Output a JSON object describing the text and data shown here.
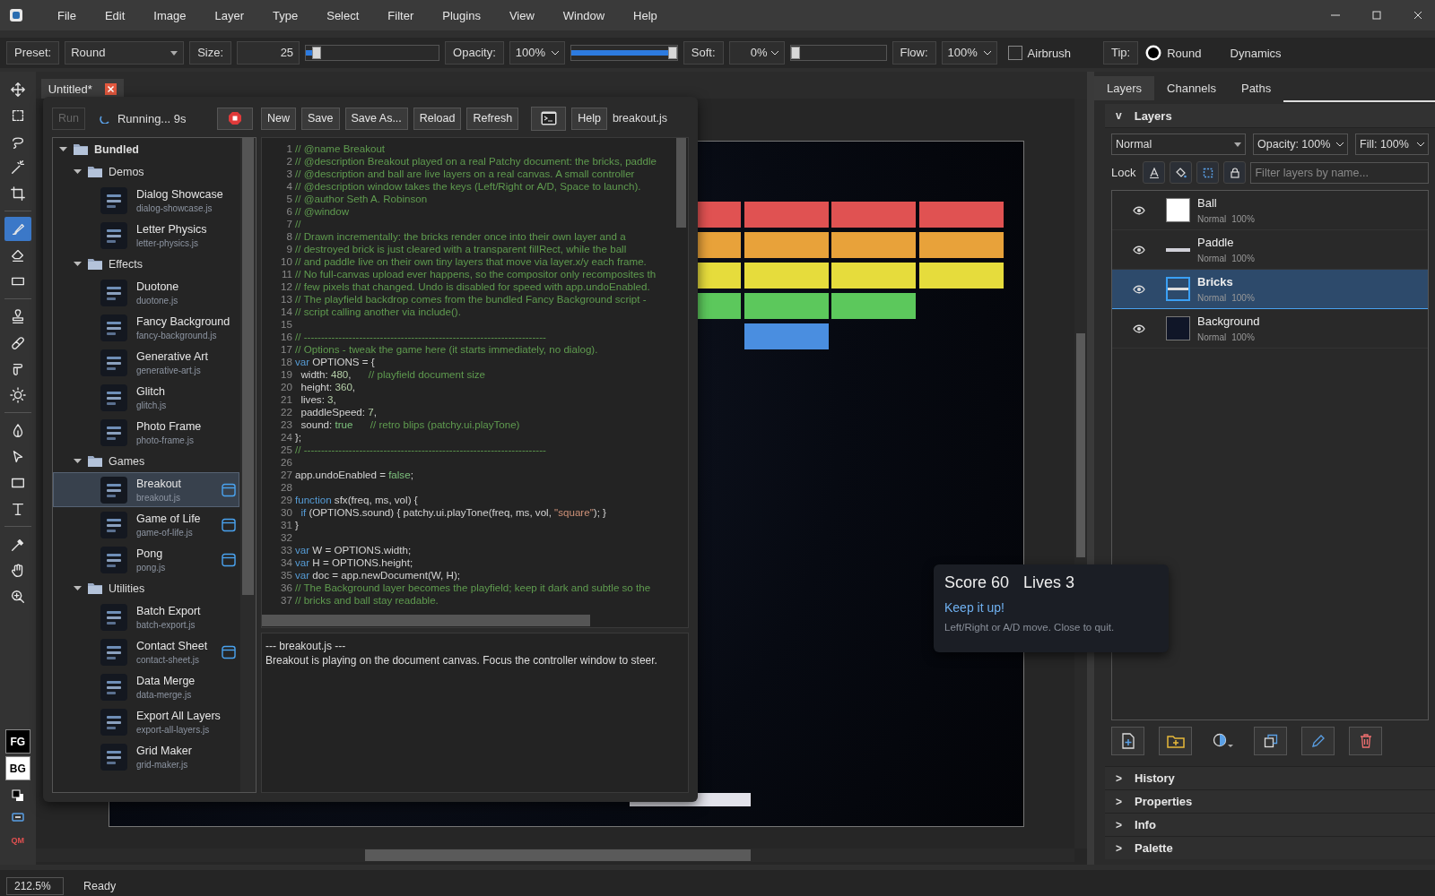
{
  "menu": [
    "File",
    "Edit",
    "Image",
    "Layer",
    "Type",
    "Select",
    "Filter",
    "Plugins",
    "View",
    "Window",
    "Help"
  ],
  "tool_options": {
    "preset_label": "Preset:",
    "preset": "Round",
    "size_label": "Size:",
    "size": "25",
    "size_slider": {
      "level": 0.05
    },
    "opacity_label": "Opacity:",
    "opacity": "100%",
    "opacity_slider": {
      "level": 1
    },
    "soft_label": "Soft:",
    "soft": "0%",
    "soft_slider": {
      "level": 0
    },
    "flow_label": "Flow:",
    "flow": "100%",
    "airbrush": {
      "label": "Airbrush",
      "checked": false
    },
    "tip_label": "Tip:",
    "tip": "Round",
    "dynamics": "Dynamics"
  },
  "tools": [
    {
      "kind": "move",
      "selected": false,
      "separator_after": false
    },
    {
      "kind": "marquee",
      "selected": false,
      "separator_after": false
    },
    {
      "kind": "lasso",
      "selected": false,
      "separator_after": false
    },
    {
      "kind": "wand",
      "selected": false,
      "separator_after": false
    },
    {
      "kind": "crop",
      "selected": false,
      "separator_after": true
    },
    {
      "kind": "brush",
      "selected": true,
      "separator_after": false
    },
    {
      "kind": "eraser",
      "selected": false,
      "separator_after": false
    },
    {
      "kind": "gradient",
      "selected": false,
      "separator_after": true
    },
    {
      "kind": "stamp",
      "selected": false,
      "separator_after": false
    },
    {
      "kind": "heal",
      "selected": false,
      "separator_after": false
    },
    {
      "kind": "smudge",
      "selected": false,
      "separator_after": false
    },
    {
      "kind": "dodge",
      "selected": false,
      "separator_after": true
    },
    {
      "kind": "pen",
      "selected": false,
      "separator_after": false
    },
    {
      "kind": "pointer",
      "selected": false,
      "separator_after": false
    },
    {
      "kind": "rect",
      "selected": false,
      "separator_after": false
    },
    {
      "kind": "text",
      "selected": false,
      "separator_after": true
    },
    {
      "kind": "eyedropper",
      "selected": false,
      "separator_after": false
    },
    {
      "kind": "hand",
      "selected": false,
      "separator_after": false
    },
    {
      "kind": "zoom",
      "selected": false,
      "separator_after": false
    }
  ],
  "colors": {
    "fg": "FG",
    "bg": "BG",
    "quick_mask": "QM"
  },
  "document": {
    "tab": "Untitled*"
  },
  "script_editor": {
    "run": {
      "label": "Run",
      "disabled": true
    },
    "status": "Running... 9s",
    "buttons": [
      "New",
      "Save",
      "Save As...",
      "Reload",
      "Refresh"
    ],
    "help": "Help",
    "file": "breakout.js",
    "tree": [
      {
        "kind": "folder",
        "name": "Bundled",
        "expanded": true,
        "children": [
          {
            "kind": "folder",
            "name": "Demos",
            "expanded": true,
            "children": [
              {
                "kind": "script",
                "name": "Dialog Showcase",
                "file": "dialog-showcase.js",
                "window": false,
                "selected": false
              },
              {
                "kind": "script",
                "name": "Letter Physics",
                "file": "letter-physics.js",
                "window": false,
                "selected": false
              }
            ]
          },
          {
            "kind": "folder",
            "name": "Effects",
            "expanded": true,
            "children": [
              {
                "kind": "script",
                "name": "Duotone",
                "file": "duotone.js",
                "window": false,
                "selected": false
              },
              {
                "kind": "script",
                "name": "Fancy Background",
                "file": "fancy-background.js",
                "window": false,
                "selected": false
              },
              {
                "kind": "script",
                "name": "Generative Art",
                "file": "generative-art.js",
                "window": false,
                "selected": false
              },
              {
                "kind": "script",
                "name": "Glitch",
                "file": "glitch.js",
                "window": false,
                "selected": false
              },
              {
                "kind": "script",
                "name": "Photo Frame",
                "file": "photo-frame.js",
                "window": false,
                "selected": false
              }
            ]
          },
          {
            "kind": "folder",
            "name": "Games",
            "expanded": true,
            "children": [
              {
                "kind": "script",
                "name": "Breakout",
                "file": "breakout.js",
                "window": true,
                "selected": true
              },
              {
                "kind": "script",
                "name": "Game of Life",
                "file": "game-of-life.js",
                "window": true,
                "selected": false
              },
              {
                "kind": "script",
                "name": "Pong",
                "file": "pong.js",
                "window": true,
                "selected": false
              }
            ]
          },
          {
            "kind": "folder",
            "name": "Utilities",
            "expanded": true,
            "children": [
              {
                "kind": "script",
                "name": "Batch Export",
                "file": "batch-export.js",
                "window": false,
                "selected": false
              },
              {
                "kind": "script",
                "name": "Contact Sheet",
                "file": "contact-sheet.js",
                "window": true,
                "selected": false
              },
              {
                "kind": "script",
                "name": "Data Merge",
                "file": "data-merge.js",
                "window": false,
                "selected": false
              },
              {
                "kind": "script",
                "name": "Export All Layers",
                "file": "export-all-layers.js",
                "window": false,
                "selected": false
              },
              {
                "kind": "script",
                "name": "Grid Maker",
                "file": "grid-maker.js",
                "window": false,
                "selected": false
              }
            ]
          }
        ]
      }
    ],
    "code": [
      {
        "number": "1",
        "tokens": [
          {
            "kind": "comment",
            "text": "// @name Breakout"
          }
        ]
      },
      {
        "number": "2",
        "tokens": [
          {
            "kind": "comment",
            "text": "// @description Breakout played on a real Patchy document: the bricks, paddle"
          }
        ]
      },
      {
        "number": "3",
        "tokens": [
          {
            "kind": "comment",
            "text": "// @description and ball are live layers on a real canvas. A small controller"
          }
        ]
      },
      {
        "number": "4",
        "tokens": [
          {
            "kind": "comment",
            "text": "// @description window takes the keys (Left/Right or A/D, Space to launch)."
          }
        ]
      },
      {
        "number": "5",
        "tokens": [
          {
            "kind": "comment",
            "text": "// @author Seth A. Robinson"
          }
        ]
      },
      {
        "number": "6",
        "tokens": [
          {
            "kind": "comment",
            "text": "// @window"
          }
        ]
      },
      {
        "number": "7",
        "tokens": [
          {
            "kind": "comment",
            "text": "//"
          }
        ]
      },
      {
        "number": "8",
        "tokens": [
          {
            "kind": "comment",
            "text": "// Drawn incrementally: the bricks render once into their own layer and a"
          }
        ]
      },
      {
        "number": "9",
        "tokens": [
          {
            "kind": "comment",
            "text": "// destroyed brick is just cleared with a transparent fillRect, while the ball"
          }
        ]
      },
      {
        "number": "10",
        "tokens": [
          {
            "kind": "comment",
            "text": "// and paddle live on their own tiny layers that move via layer.x/y each frame."
          }
        ]
      },
      {
        "number": "11",
        "tokens": [
          {
            "kind": "comment",
            "text": "// No full-canvas upload ever happens, so the compositor only recomposites th"
          }
        ]
      },
      {
        "number": "12",
        "tokens": [
          {
            "kind": "comment",
            "text": "// few pixels that changed. Undo is disabled for speed with app.undoEnabled."
          }
        ]
      },
      {
        "number": "13",
        "tokens": [
          {
            "kind": "comment",
            "text": "// The playfield backdrop comes from the bundled Fancy Background script -"
          }
        ]
      },
      {
        "number": "14",
        "tokens": [
          {
            "kind": "comment",
            "text": "// script calling another via include()."
          }
        ]
      },
      {
        "number": "15"
      },
      {
        "number": "16",
        "tokens": [
          {
            "kind": "comment",
            "text": "// ----------------------------------------------------------------------"
          }
        ]
      },
      {
        "number": "17",
        "tokens": [
          {
            "kind": "comment",
            "text": "// Options - tweak the game here (it starts immediately, no dialog)."
          }
        ]
      },
      {
        "number": "18",
        "tokens": [
          {
            "kind": "keyword",
            "text": "var"
          },
          {
            "kind": "plain",
            "text": " OPTIONS = {"
          }
        ]
      },
      {
        "number": "19",
        "tokens": [
          {
            "kind": "plain",
            "text": "  width: "
          },
          {
            "kind": "number",
            "text": "480"
          },
          {
            "kind": "plain",
            "text": ",      "
          },
          {
            "kind": "comment",
            "text": "// playfield document size"
          }
        ]
      },
      {
        "number": "20",
        "tokens": [
          {
            "kind": "plain",
            "text": "  height: "
          },
          {
            "kind": "number",
            "text": "360"
          },
          {
            "kind": "plain",
            "text": ","
          }
        ]
      },
      {
        "number": "21",
        "tokens": [
          {
            "kind": "plain",
            "text": "  lives: "
          },
          {
            "kind": "number",
            "text": "3"
          },
          {
            "kind": "plain",
            "text": ","
          }
        ]
      },
      {
        "number": "22",
        "tokens": [
          {
            "kind": "plain",
            "text": "  paddleSpeed: "
          },
          {
            "kind": "number",
            "text": "7"
          },
          {
            "kind": "plain",
            "text": ","
          }
        ]
      },
      {
        "number": "23",
        "tokens": [
          {
            "kind": "plain",
            "text": "  sound: "
          },
          {
            "kind": "literal",
            "text": "true"
          },
          {
            "kind": "comment",
            "text": "      // retro blips (patchy.ui.playTone)"
          }
        ]
      },
      {
        "number": "24",
        "tokens": [
          {
            "kind": "plain",
            "text": "};"
          }
        ]
      },
      {
        "number": "25",
        "tokens": [
          {
            "kind": "comment",
            "text": "// ----------------------------------------------------------------------"
          }
        ]
      },
      {
        "number": "26"
      },
      {
        "number": "27",
        "tokens": [
          {
            "kind": "plain",
            "text": "app.undoEnabled = "
          },
          {
            "kind": "literal",
            "text": "false"
          },
          {
            "kind": "plain",
            "text": ";"
          }
        ]
      },
      {
        "number": "28"
      },
      {
        "number": "29",
        "tokens": [
          {
            "kind": "keyword",
            "text": "function"
          },
          {
            "kind": "plain",
            "text": " sfx(freq, ms, vol) {"
          }
        ]
      },
      {
        "number": "30",
        "tokens": [
          {
            "kind": "keyword",
            "text": "  if"
          },
          {
            "kind": "plain",
            "text": " (OPTIONS.sound) { patchy.ui.playTone(freq, ms, vol, "
          },
          {
            "kind": "string",
            "text": "\"square\""
          },
          {
            "kind": "plain",
            "text": "); }"
          }
        ]
      },
      {
        "number": "31",
        "tokens": [
          {
            "kind": "plain",
            "text": "}"
          }
        ]
      },
      {
        "number": "32"
      },
      {
        "number": "33",
        "tokens": [
          {
            "kind": "keyword",
            "text": "var"
          },
          {
            "kind": "plain",
            "text": " W = OPTIONS.width;"
          }
        ]
      },
      {
        "number": "34",
        "tokens": [
          {
            "kind": "keyword",
            "text": "var"
          },
          {
            "kind": "plain",
            "text": " H = OPTIONS.height;"
          }
        ]
      },
      {
        "number": "35",
        "tokens": [
          {
            "kind": "keyword",
            "text": "var"
          },
          {
            "kind": "plain",
            "text": " doc = app.newDocument(W, H);"
          }
        ]
      },
      {
        "number": "36",
        "tokens": [
          {
            "kind": "comment",
            "text": "// The Background layer becomes the playfield; keep it dark and subtle so the"
          }
        ]
      },
      {
        "number": "37",
        "tokens": [
          {
            "kind": "comment",
            "text": "// bricks and ball stay readable."
          }
        ]
      }
    ],
    "output": [
      "--- breakout.js ---",
      "Breakout is playing on the document canvas. Focus the controller window to steer."
    ]
  },
  "controller": {
    "score": "Score 60",
    "lives": "Lives 3",
    "message": "Keep it up!",
    "hint": "Left/Right or A/D move. Close to quit."
  },
  "layers_panel": {
    "tabs": [
      {
        "label": "Layers",
        "selected": true
      },
      {
        "label": "Channels",
        "selected": false
      },
      {
        "label": "Paths",
        "selected": false
      }
    ],
    "section": {
      "toggle": "v",
      "title": "Layers"
    },
    "blend": "Normal",
    "opacity": "Opacity: 100%",
    "fill": "Fill: 100%",
    "lock_label": "Lock",
    "filter": {
      "placeholder": "Filter layers by name..."
    },
    "layers": [
      {
        "kind": "ball",
        "name": "Ball",
        "mode": "Normal",
        "opacity": "100%",
        "visible": true,
        "selected": false
      },
      {
        "kind": "paddle",
        "name": "Paddle",
        "mode": "Normal",
        "opacity": "100%",
        "visible": true,
        "selected": false
      },
      {
        "kind": "bricks",
        "name": "Bricks",
        "mode": "Normal",
        "opacity": "100%",
        "visible": true,
        "selected": true
      },
      {
        "kind": "background",
        "name": "Background",
        "mode": "Normal",
        "opacity": "100%",
        "visible": true,
        "selected": false
      }
    ],
    "collapsed_sections": [
      {
        "toggle": ">",
        "title": "History"
      },
      {
        "toggle": ">",
        "title": "Properties"
      },
      {
        "toggle": ">",
        "title": "Info"
      },
      {
        "toggle": ">",
        "title": "Palette"
      }
    ]
  },
  "status_bar": {
    "zoom": "212.5%",
    "message": "Ready"
  }
}
